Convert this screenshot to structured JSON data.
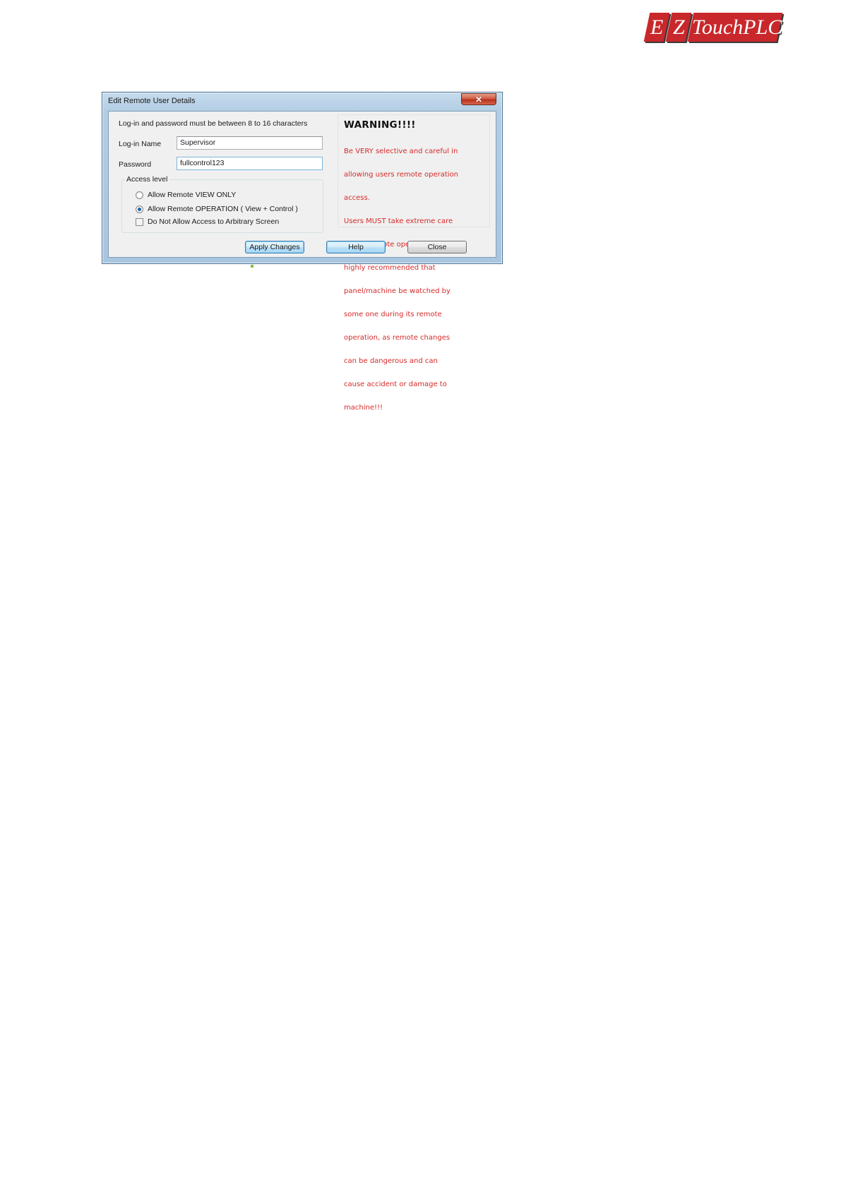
{
  "logo": {
    "letter_e": "E",
    "letter_z": "Z",
    "name": "TouchPLC"
  },
  "dialog": {
    "title": "Edit Remote User Details",
    "close_icon": "close-icon",
    "hint": "Log-in and password must be between 8 to 16 characters",
    "login_label": "Log-in Name",
    "login_value": "Supervisor",
    "password_label": "Password",
    "password_value": "fullcontrol123",
    "access_level": {
      "legend": "Access level",
      "option_view": "Allow Remote VIEW ONLY",
      "option_operation": "Allow Remote OPERATION ( View + Control )",
      "selected": "option_operation",
      "checkbox_label": "Do Not Allow Access to Arbitrary Screen",
      "checkbox_checked": false
    },
    "warning": {
      "title": "WARNING!!!!",
      "lines": [
        "Be VERY selective and careful in",
        "allowing users remote operation",
        "access.",
        "Users MUST take extreme care",
        "during remote operation.It is",
        "highly recommended that",
        "panel/machine be watched by",
        "some one during its remote",
        "operation, as remote changes",
        "can be dangerous and can",
        "cause accident or damage to",
        "machine!!!"
      ]
    },
    "buttons": {
      "apply": "Apply Changes",
      "help": "Help",
      "close": "Close"
    }
  },
  "colors": {
    "logo_red": "#c8282b",
    "warning_red": "#d62a2a",
    "window_frame": "#b2cde4",
    "focus_blue": "#a7d8f9"
  }
}
